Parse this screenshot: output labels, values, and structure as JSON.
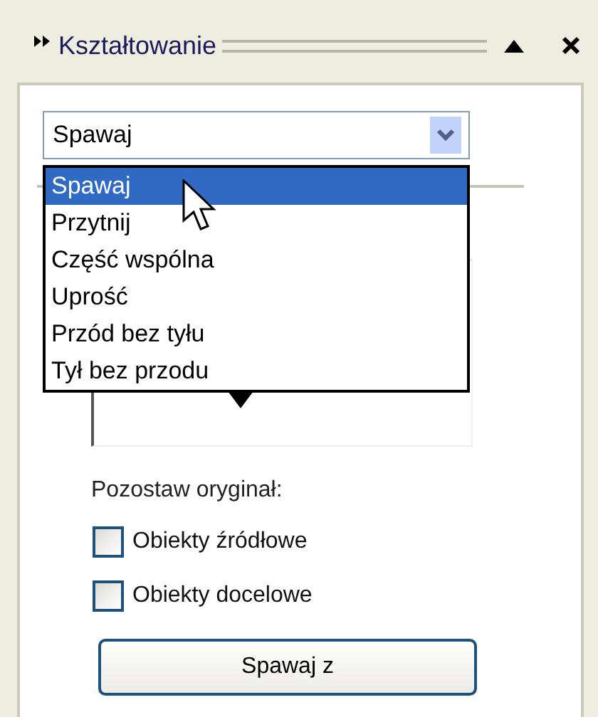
{
  "pane": {
    "title": "Kształtowanie"
  },
  "operation": {
    "value": "Spawaj",
    "expanded": true,
    "options": [
      {
        "label": "Spawaj",
        "selected": true
      },
      {
        "label": "Przytnij",
        "selected": false
      },
      {
        "label": "Część wspólna",
        "selected": false
      },
      {
        "label": "Uprość",
        "selected": false
      },
      {
        "label": "Przód bez tyłu",
        "selected": false
      },
      {
        "label": "Tył bez przodu",
        "selected": false
      }
    ]
  },
  "keep_original": {
    "label": "Pozostaw oryginał:",
    "options": [
      {
        "label": "Obiekty źródłowe",
        "checked": false
      },
      {
        "label": "Obiekty docelowe",
        "checked": false
      }
    ]
  },
  "apply_button": "Spawaj z"
}
